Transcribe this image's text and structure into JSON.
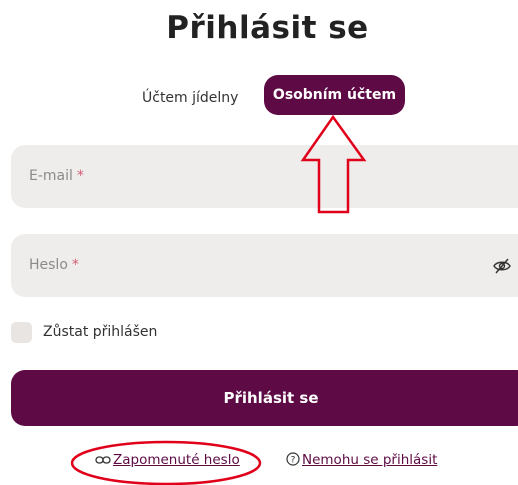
{
  "heading": "Přihlásit se",
  "tabs": [
    {
      "label": "Účtem jídelny"
    },
    {
      "label": "Osobním účtem"
    }
  ],
  "fields": {
    "email": {
      "placeholder": "E-mail",
      "required": "*"
    },
    "password": {
      "placeholder": "Heslo",
      "required": "*"
    }
  },
  "remember": {
    "label": "Zůstat přihlášen"
  },
  "submit": {
    "label": "Přihlásit se"
  },
  "links": {
    "forgot": {
      "label": "Zapomenuté heslo",
      "icon": "link-icon"
    },
    "cannot_login": {
      "label": "Nemohu se přihlásit",
      "icon": "help-circle-icon"
    }
  },
  "colors": {
    "brand": "#5e0a45",
    "field_bg": "#efedeb",
    "annotation": "#e0001a"
  }
}
